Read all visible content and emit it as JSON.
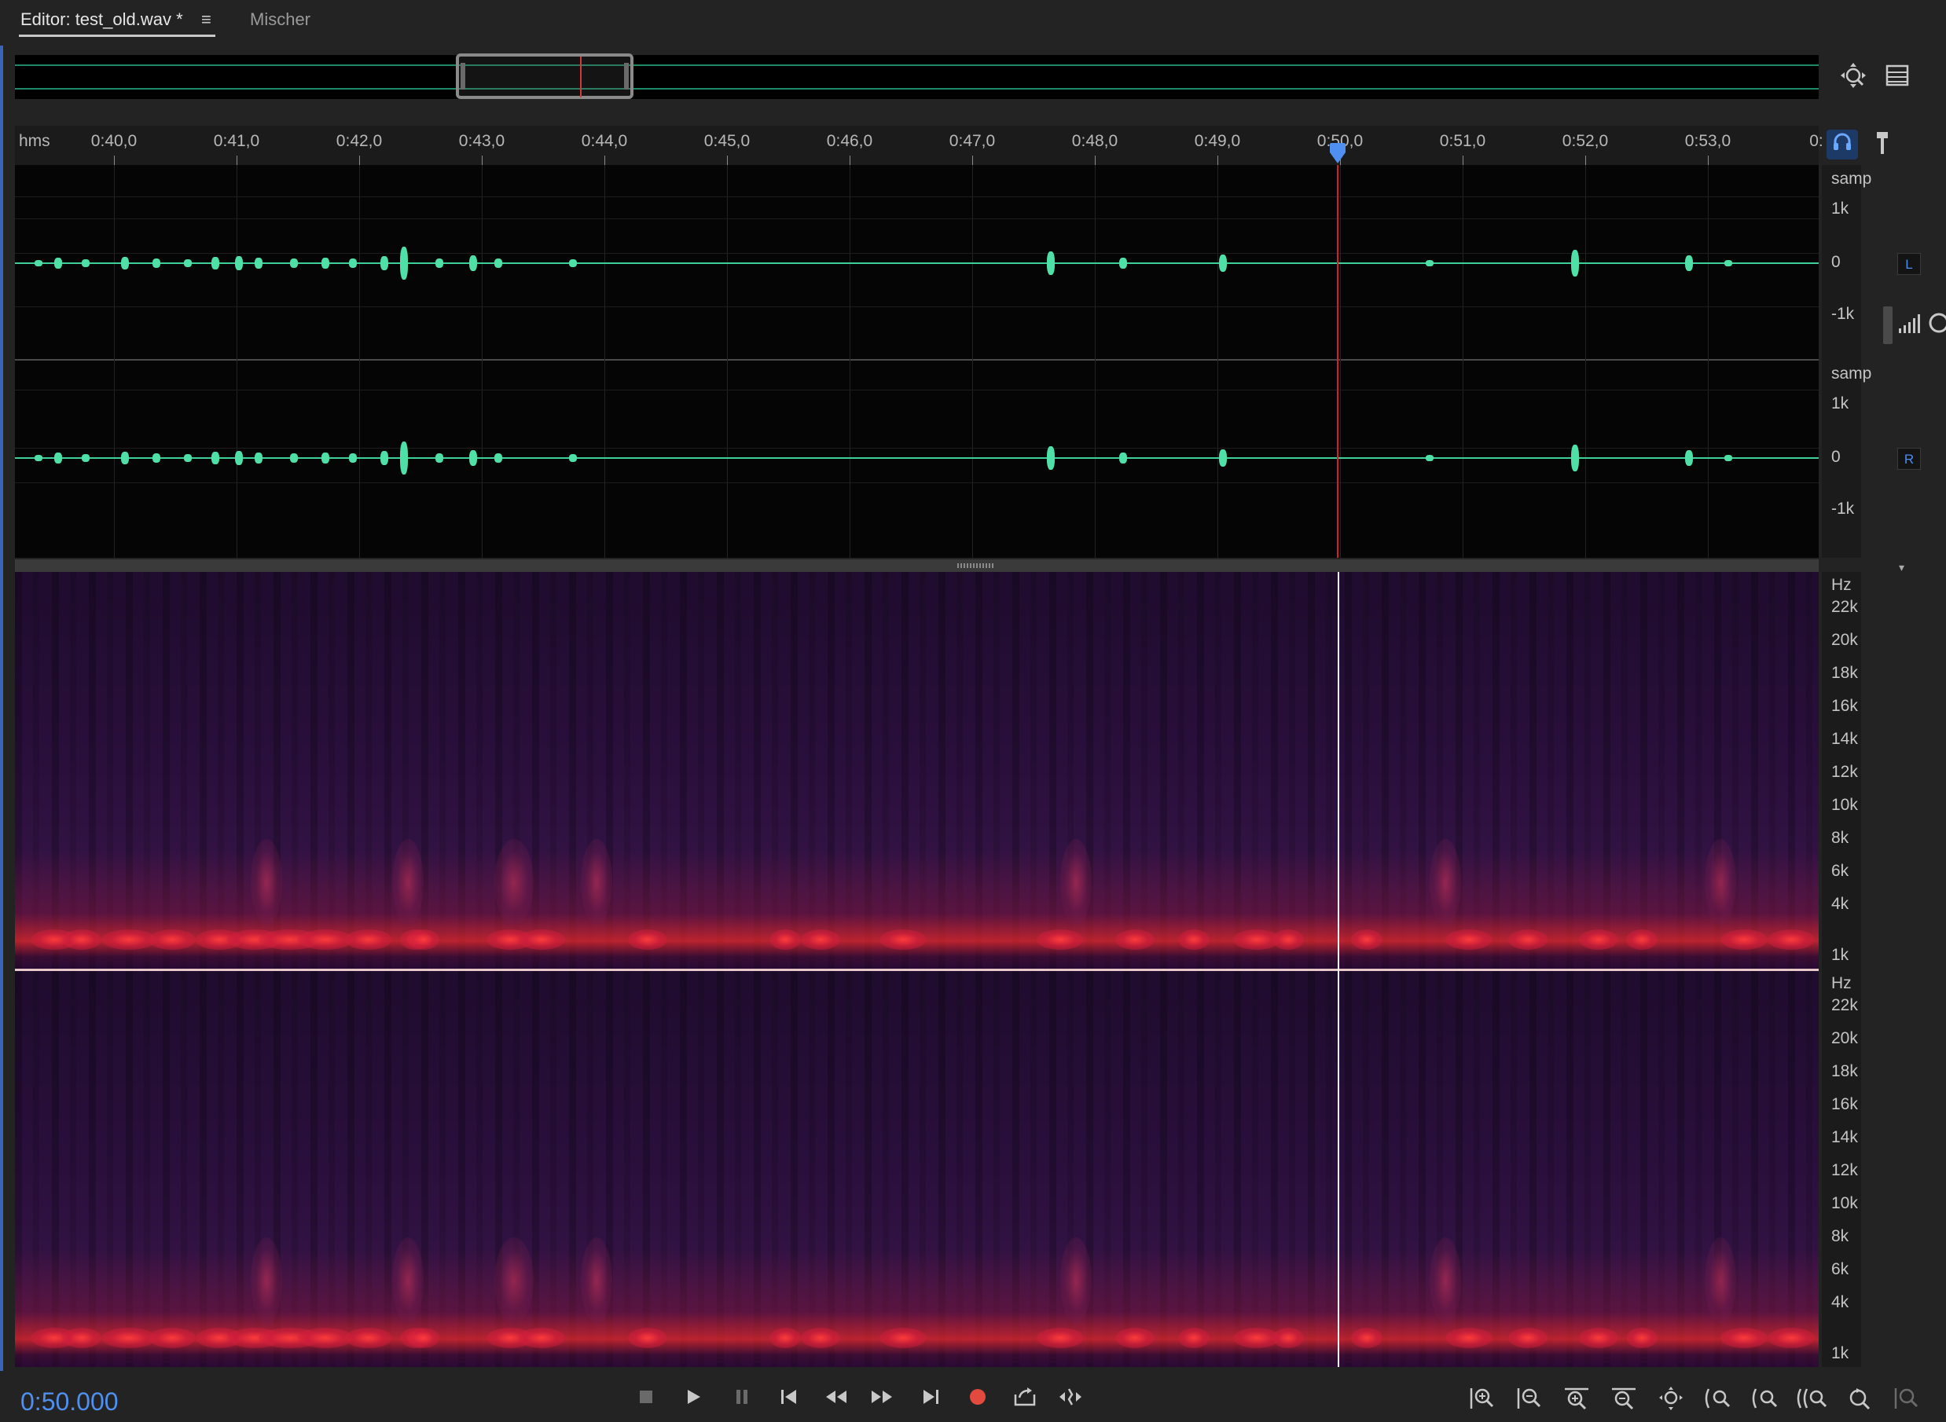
{
  "tabs": {
    "editor_label": "Editor: test_old.wav *",
    "menu_icon": "≡",
    "mixer_label": "Mischer"
  },
  "ruler": {
    "unit": "hms",
    "ticks": [
      "0:40,0",
      "0:41,0",
      "0:42,0",
      "0:43,0",
      "0:44,0",
      "0:45,0",
      "0:46,0",
      "0:47,0",
      "0:48,0",
      "0:49,0",
      "0:50,0",
      "0:51,0",
      "0:52,0",
      "0:53,0",
      "0:"
    ]
  },
  "waveform": {
    "left": {
      "unit": "samp",
      "labels": [
        "1k",
        "0",
        "-1k"
      ],
      "channel": "L"
    },
    "right": {
      "unit": "samp",
      "labels": [
        "1k",
        "0",
        "-1k"
      ],
      "channel": "R"
    }
  },
  "spectral": {
    "unit": "Hz",
    "labels": [
      "22k",
      "20k",
      "18k",
      "16k",
      "14k",
      "12k",
      "10k",
      "8k",
      "6k",
      "4k",
      "1k"
    ]
  },
  "transport": {
    "timecode": "0:50.000"
  },
  "icons": {
    "zoom_overview": "zoom-full-icon",
    "list": "list-icon",
    "headphones": "headphones-icon",
    "marker": "marker-pin-icon"
  },
  "colors": {
    "accent": "#4f8ff0",
    "waveform": "#3fcf9a",
    "playhead": "#d21f2a",
    "record": "#e24a3f"
  }
}
